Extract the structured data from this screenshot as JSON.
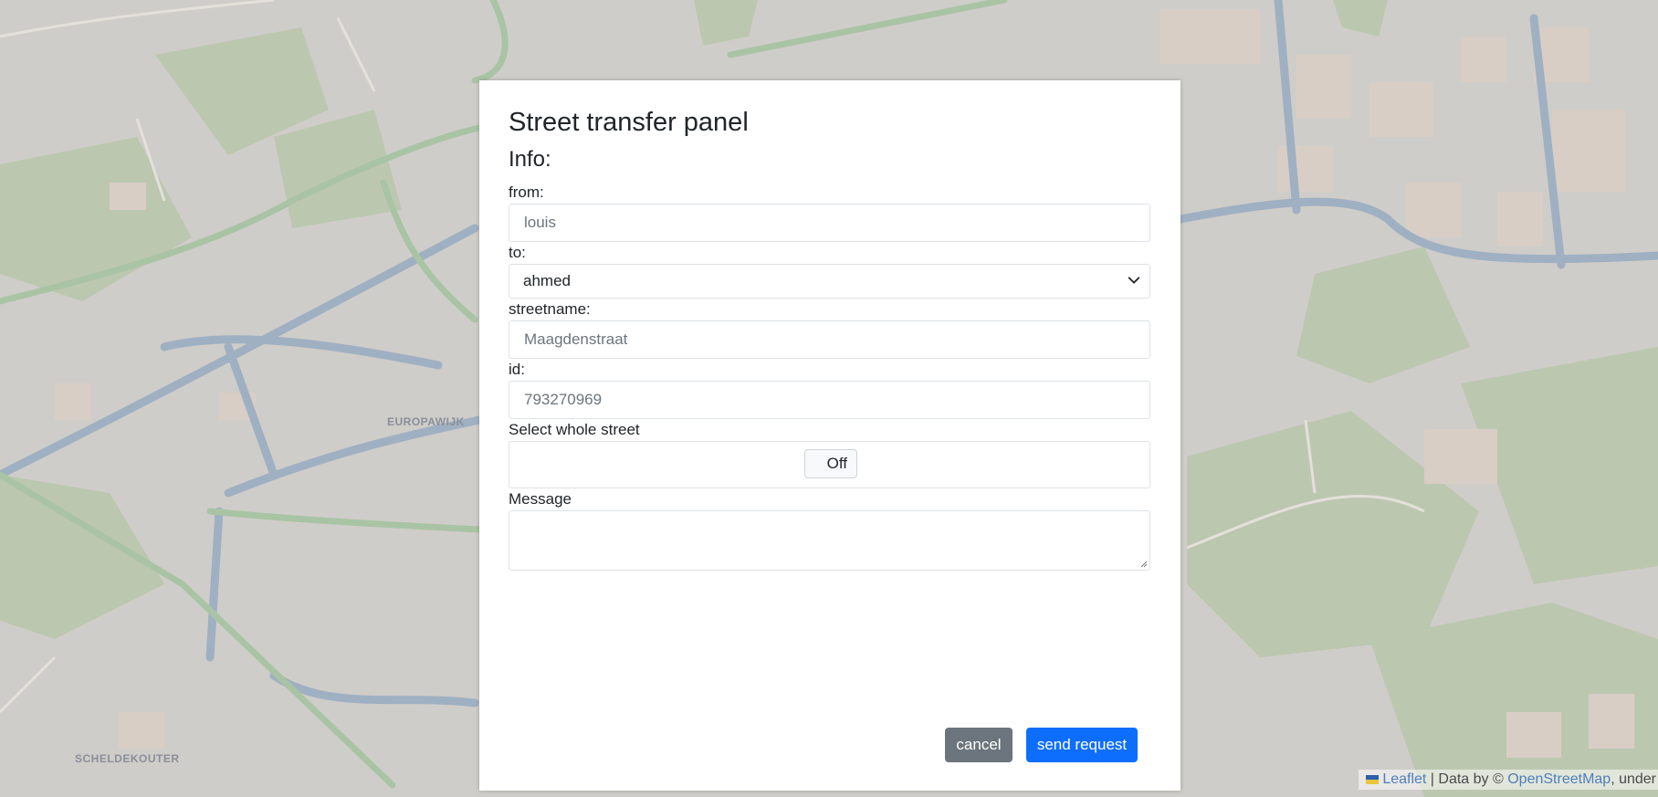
{
  "modal": {
    "title": "Street transfer panel",
    "subtitle": "Info:",
    "from": {
      "label": "from:",
      "placeholder": "louis"
    },
    "to": {
      "label": "to:",
      "selected": "ahmed"
    },
    "streetname": {
      "label": "streetname:",
      "placeholder": "Maagdenstraat"
    },
    "id": {
      "label": "id:",
      "placeholder": "793270969"
    },
    "whole_street": {
      "label": "Select whole street",
      "toggle_text": "Off"
    },
    "message": {
      "label": "Message",
      "value": ""
    },
    "cancel_label": "cancel",
    "send_label": "send request"
  },
  "map": {
    "labels": [
      "EUROPAWIJK",
      "SCHELDEKOUTER"
    ],
    "attribution": {
      "leaflet": "Leaflet",
      "separator": " | Data by © ",
      "osm": "OpenStreetMap",
      "tail": ", under"
    }
  },
  "colors": {
    "primary": "#0d6efd",
    "secondary": "#6c757d",
    "map_bg": "#cfcdc9"
  }
}
